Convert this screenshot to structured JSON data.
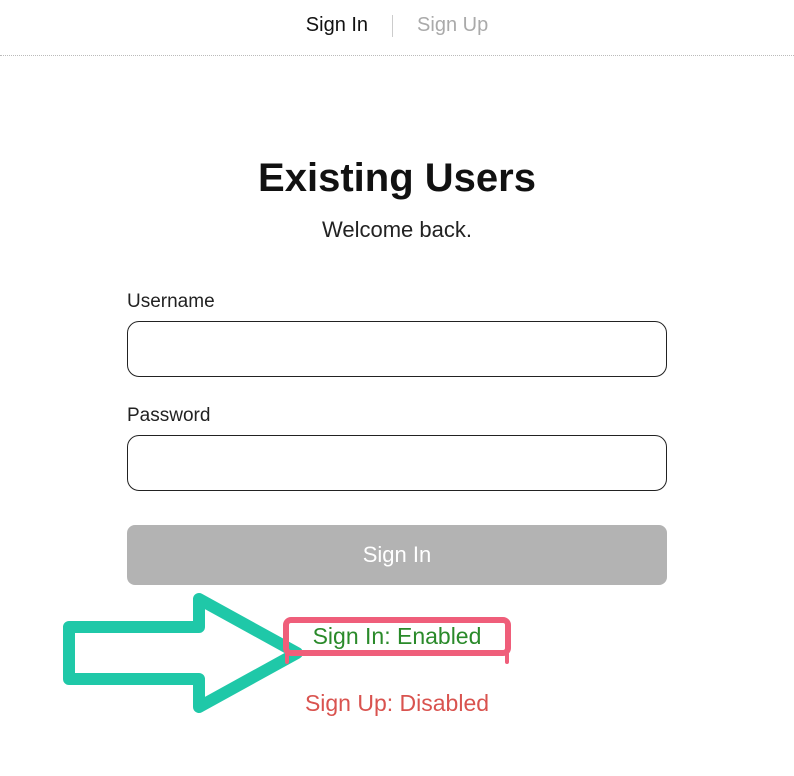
{
  "tabs": {
    "signin": "Sign In",
    "signup": "Sign Up"
  },
  "page": {
    "heading": "Existing Users",
    "subheading": "Welcome back."
  },
  "form": {
    "username_label": "Username",
    "password_label": "Password",
    "submit_label": "Sign In"
  },
  "status": {
    "signin": "Sign In: Enabled",
    "signup": "Sign Up: Disabled"
  }
}
